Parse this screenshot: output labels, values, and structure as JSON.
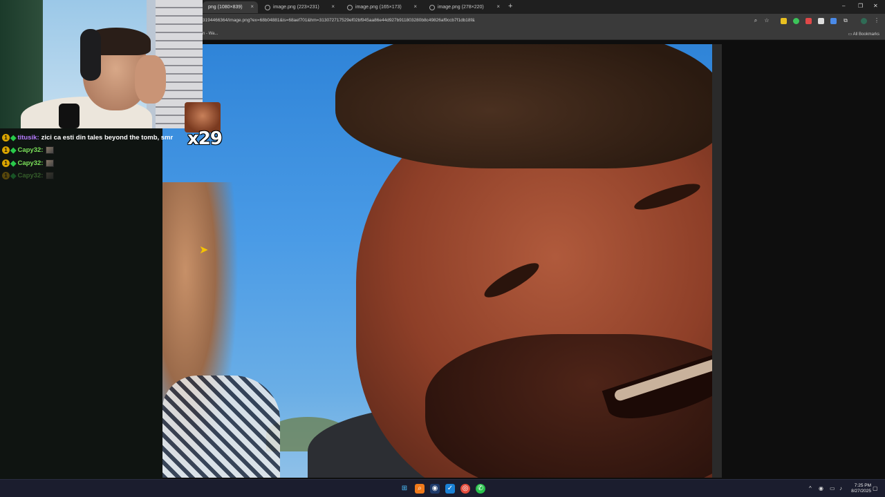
{
  "browser": {
    "tabs": [
      {
        "label": "png (1080×839)",
        "active": true
      },
      {
        "label": "image.png (223×231)",
        "active": false
      },
      {
        "label": "image.png (165×173)",
        "active": false
      },
      {
        "label": "image.png (278×220)",
        "active": false
      }
    ],
    "close_glyph": "×",
    "new_tab_glyph": "+",
    "url": "3194466364/image.png?ex=68b04881&is=68aef701&hm=313072717529ef02bf945aa86e44d927b911803280b8c49826af9ccb7f1db18f&",
    "bookmark_left": "n - Wa...",
    "bookmarks_all": "All Bookmarks",
    "window_controls": {
      "minimize": "–",
      "restore": "❐",
      "close": "✕"
    }
  },
  "overlay": {
    "emote_count": "x29",
    "chat": [
      {
        "badge": "1",
        "user": "titusik",
        "user_color": "#b67cff",
        "message": "zici ca esti din tales beyond the tomb, smr",
        "emote": false,
        "faded": false
      },
      {
        "badge": "1",
        "user": "Capy32",
        "user_color": "#7be15a",
        "message": "",
        "emote": true,
        "faded": false
      },
      {
        "badge": "1",
        "user": "Capy32",
        "user_color": "#7be15a",
        "message": "",
        "emote": true,
        "faded": false
      },
      {
        "badge": "1",
        "user": "Capy32",
        "user_color": "#7be15a",
        "message": "",
        "emote": true,
        "faded": true
      }
    ]
  },
  "taskbar": {
    "time": "7:25 PM",
    "date": "8/27/2025",
    "icons": [
      "windows-start-icon",
      "search-icon",
      "steam-icon",
      "vscode-icon",
      "chrome-icon",
      "whatsapp-icon"
    ]
  }
}
